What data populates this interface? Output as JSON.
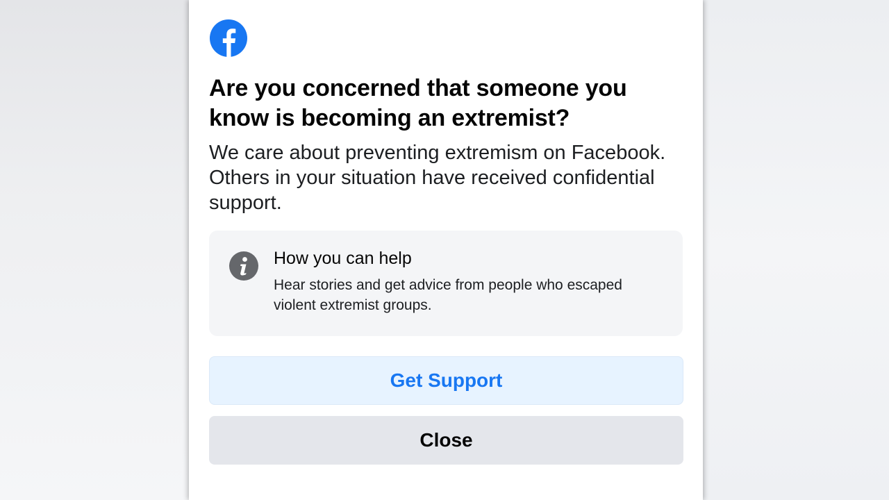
{
  "app": {
    "brand_color": "#1877f2",
    "logo_icon": "facebook-logo-icon"
  },
  "dialog": {
    "headline": "Are you concerned that someone you know is becoming an extremist?",
    "body": "We care about preventing extremism on Facebook. Others in your situation have received confidential support."
  },
  "info_card": {
    "icon": "info-icon",
    "title": "How you can help",
    "description": "Hear stories and get advice from people who escaped violent extremist groups."
  },
  "buttons": {
    "primary_label": "Get Support",
    "secondary_label": "Close"
  }
}
